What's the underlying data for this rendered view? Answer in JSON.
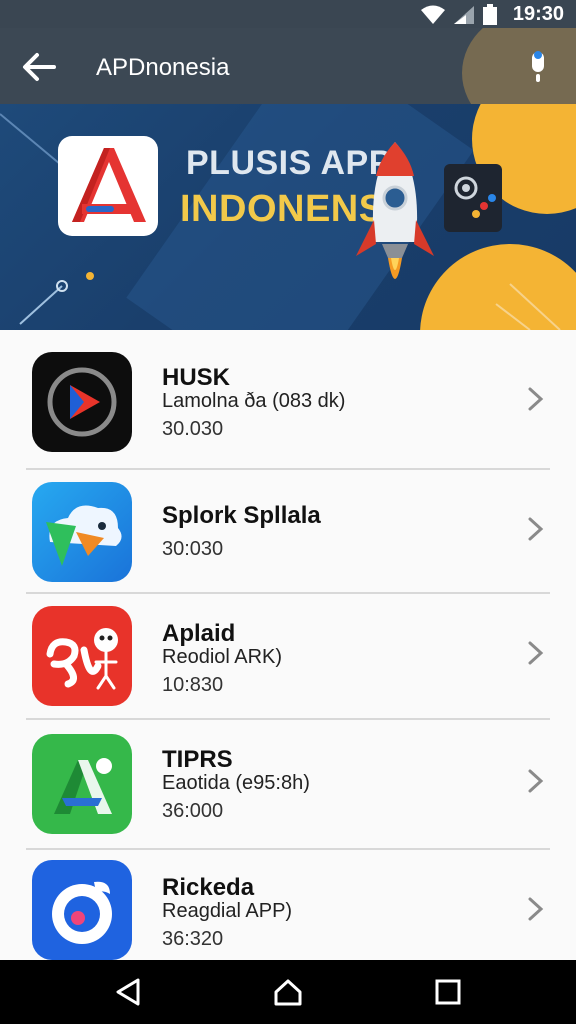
{
  "status": {
    "time": "19:30"
  },
  "appbar": {
    "title": "APDnonesia"
  },
  "banner": {
    "line1": "PLUSIS APP",
    "line2": "INDONENSI"
  },
  "apps": [
    {
      "name": "HUSK",
      "subtitle": "Lamolna ða (083 dk)",
      "meta": "30.030",
      "icon": "play-icon"
    },
    {
      "name": "Splork Spllala",
      "subtitle": "",
      "meta": "30:030",
      "icon": "cloud-bird-icon"
    },
    {
      "name": "Aplaid",
      "subtitle": "Reodiol ARK)",
      "meta": "10:830",
      "icon": "character-icon"
    },
    {
      "name": "TIPRS",
      "subtitle": "Eaotida (e95:8h)",
      "meta": "36:000",
      "icon": "letter-a-icon"
    },
    {
      "name": "Rickeda",
      "subtitle": "Reagdial APP)",
      "meta": "36:320",
      "icon": "bird-circle-icon"
    }
  ],
  "colors": {
    "appbar": "#3c4854",
    "accent": "#f4b434",
    "banner": "#1e4a7a"
  }
}
